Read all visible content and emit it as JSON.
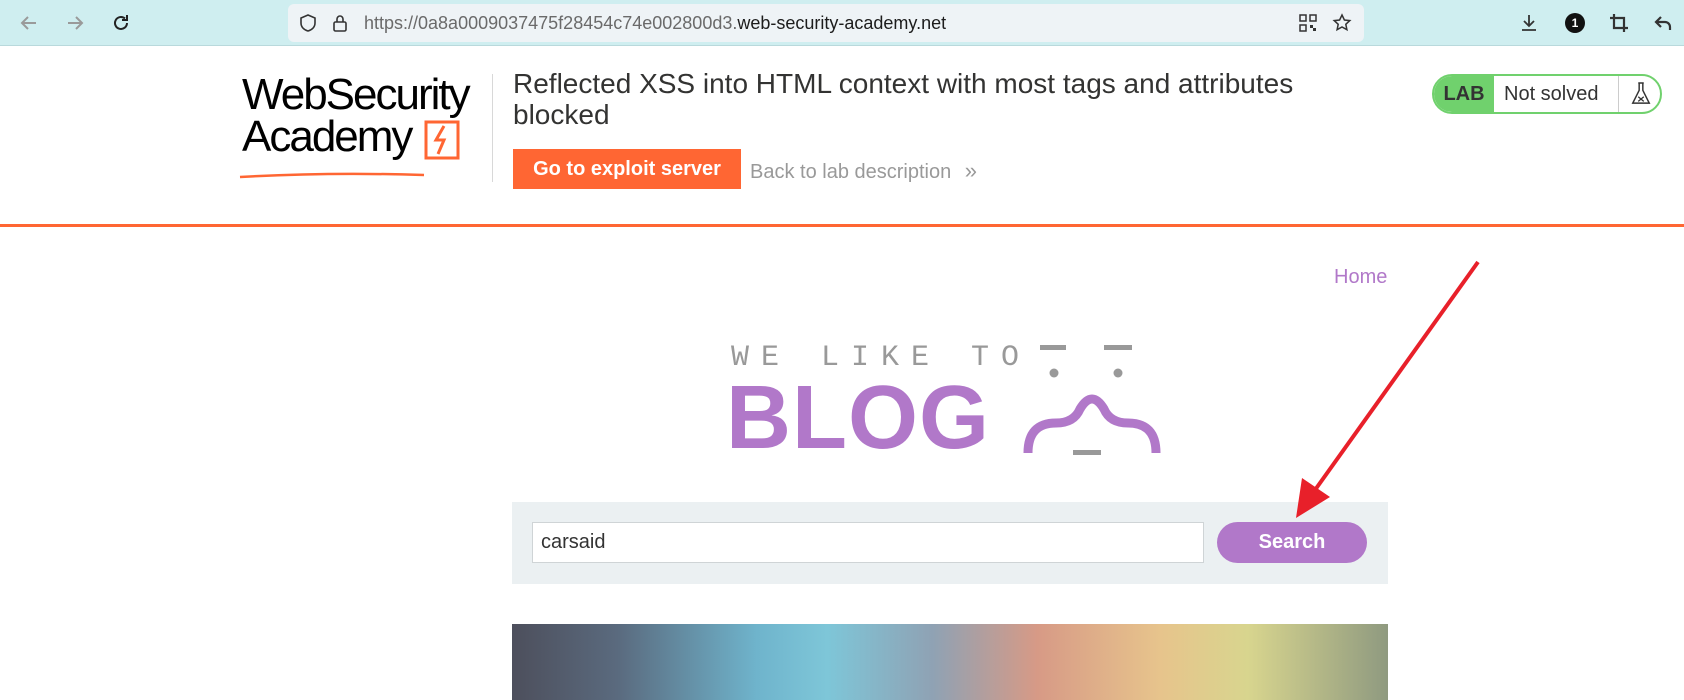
{
  "browser": {
    "url_prefix": "https://0a8a0009037475f28454c74e002800d3.",
    "url_domain": "web-security-academy.net",
    "notification_count": "1"
  },
  "lab": {
    "logo_line1": "WebSecurity",
    "logo_line2": "Academy",
    "title": "Reflected XSS into HTML context with most tags and attributes blocked",
    "exploit_button": "Go to exploit server",
    "back_link": "Back to lab description",
    "back_link_icon": "»",
    "status_badge": "LAB",
    "status_text": "Not solved",
    "accent_color": "#ff6633",
    "status_color": "#70d16d"
  },
  "blog": {
    "home_link": "Home",
    "tagline": "WE LIKE TO",
    "wordmark": "BLOG",
    "search_value": "carsaid",
    "search_button": "Search",
    "brand_color": "#b178c9"
  }
}
